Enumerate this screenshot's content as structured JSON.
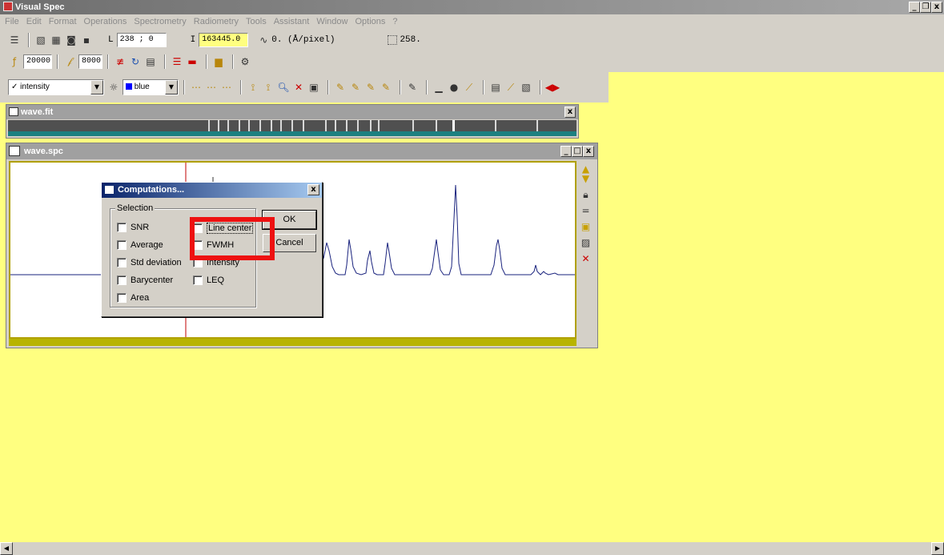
{
  "app": {
    "title": "Visual Spec"
  },
  "menu": [
    "File",
    "Edit",
    "Format",
    "Operations",
    "Spectrometry",
    "Radiometry",
    "Tools",
    "Assistant",
    "Window",
    "Options",
    "?"
  ],
  "toolbar1": {
    "l_label": "L",
    "l_value": "238 ; 0",
    "i_label": "I",
    "i_value": "163445.0",
    "dispersion_text": "0. (Å/pixel)",
    "pixel_readout": "258."
  },
  "toolbar2": {
    "value1": "20000",
    "value2": "8000"
  },
  "toolbar3": {
    "profile_select": "intensity",
    "color_select": "blue",
    "color_swatch": "#0000ff"
  },
  "windows": {
    "fit": {
      "title": "wave.fit"
    },
    "spc": {
      "title": "wave.spc"
    }
  },
  "dialog": {
    "title": "Computations...",
    "group_label": "Selection",
    "checkboxes_left": [
      "SNR",
      "Average",
      "Std deviation",
      "Barycenter",
      "Area"
    ],
    "checkboxes_right": [
      "Line center",
      "FWMH",
      "Intensity",
      "LEQ"
    ],
    "ok_label": "OK",
    "cancel_label": "Cancel"
  },
  "colors": {
    "workspace": "#ffff80",
    "highlight": "#ee1111",
    "spectrum_line": "#1a237e"
  }
}
